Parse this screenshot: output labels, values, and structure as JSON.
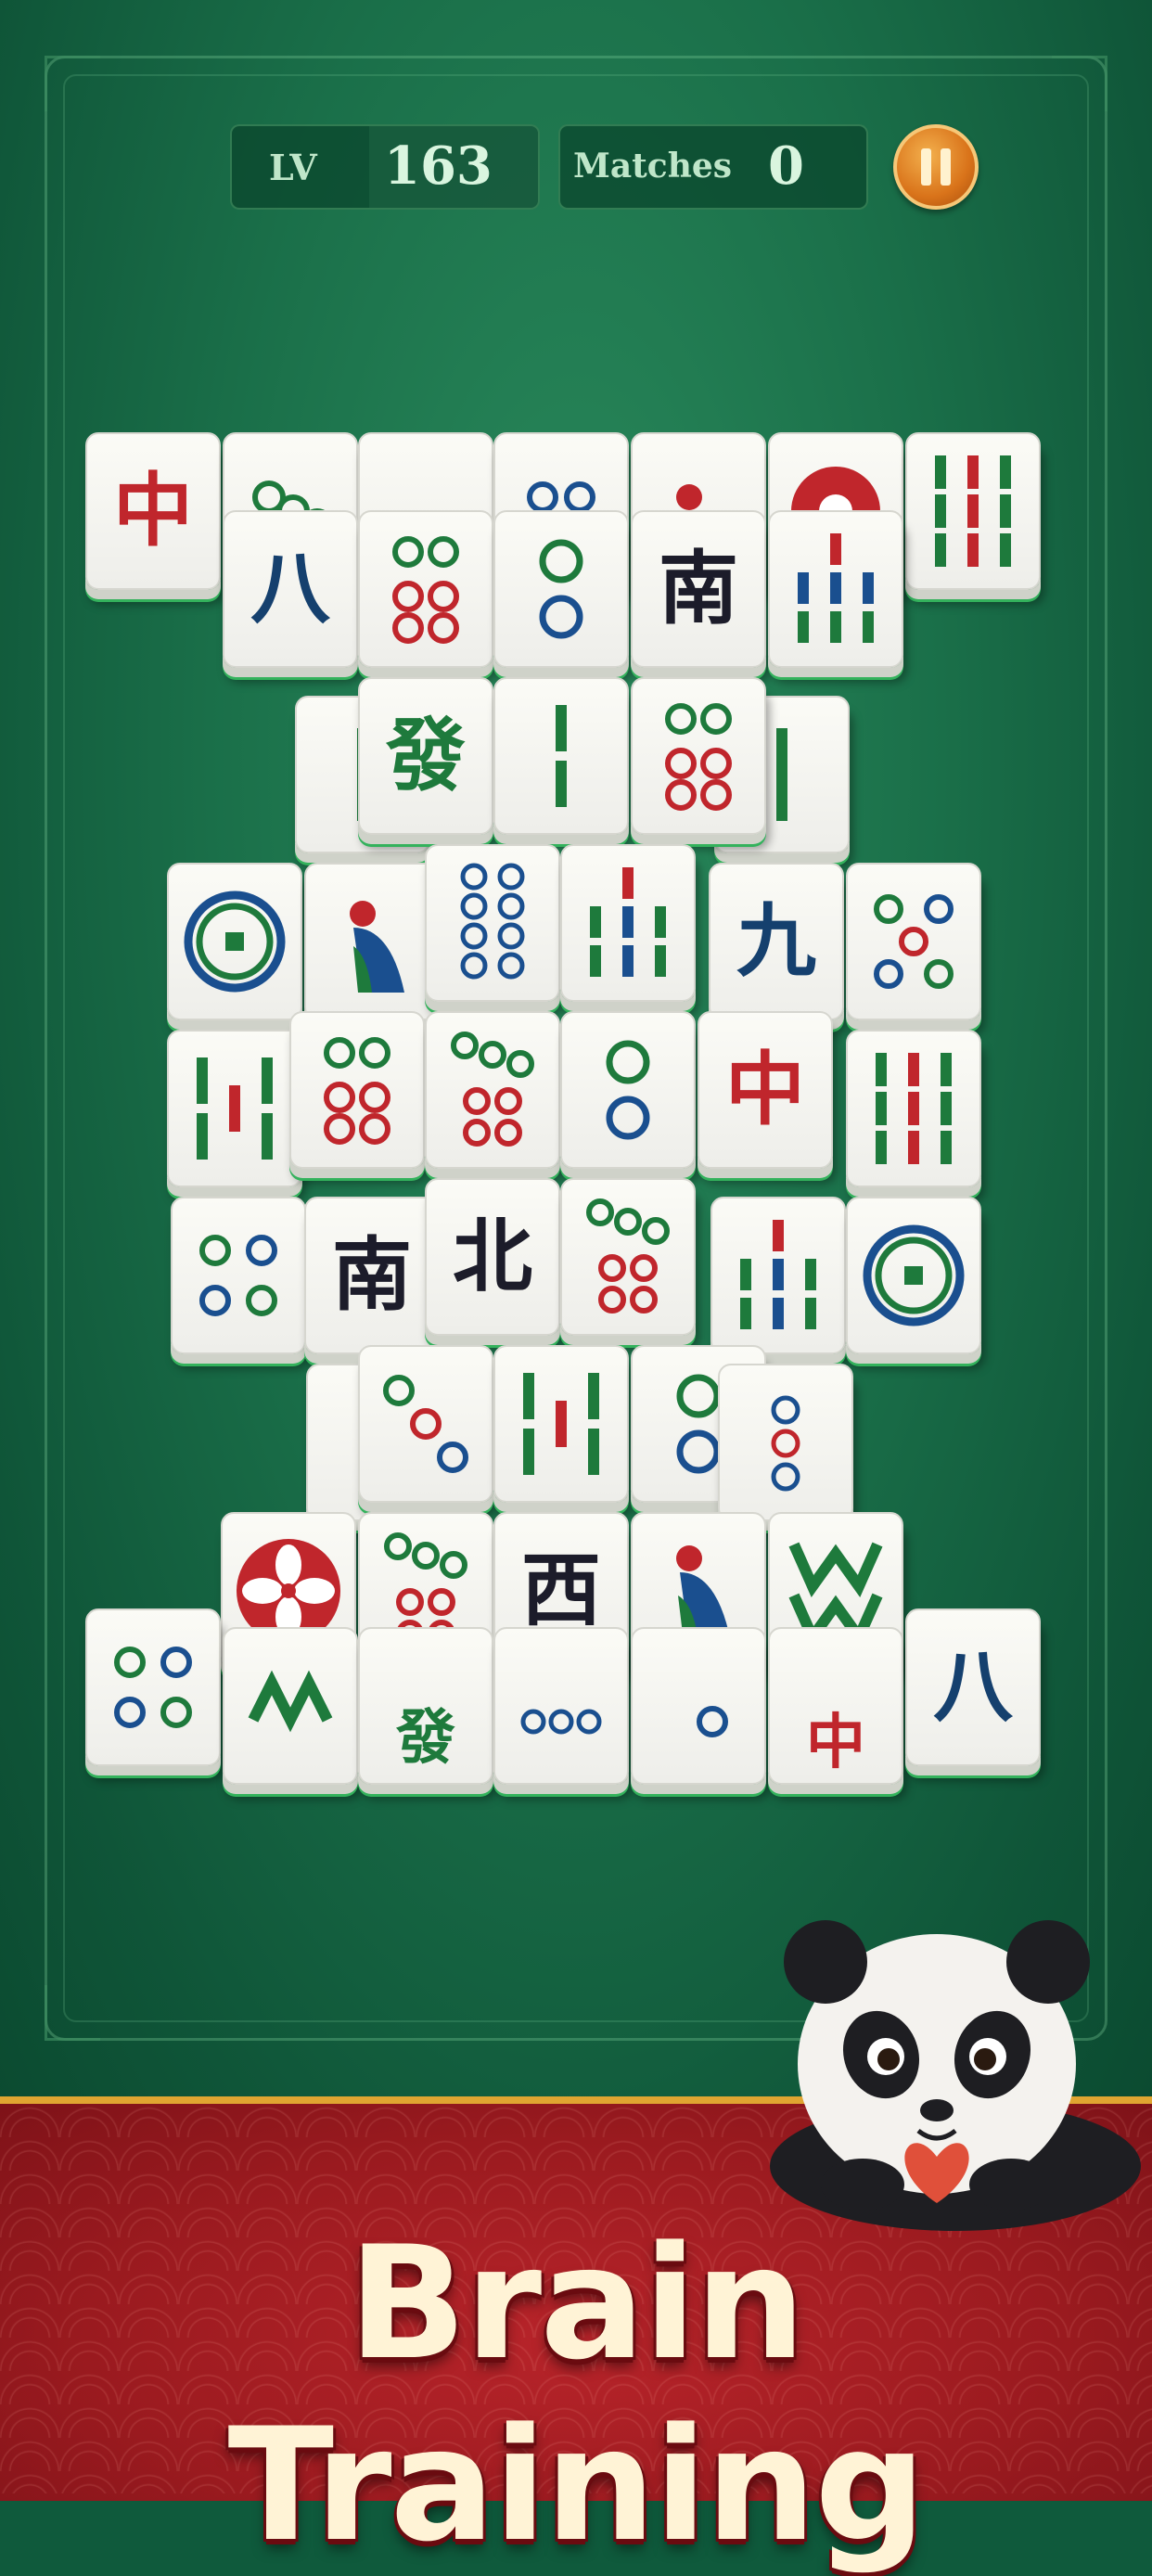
{
  "hud": {
    "level_label": "LV",
    "level_value": "163",
    "matches_label": "Matches",
    "matches_value": "0",
    "pause_icon": "pause-icon"
  },
  "tiles": {
    "t01": "中",
    "t02": "八",
    "t03": "南",
    "t04": "發",
    "t05": "九",
    "t06": "中",
    "t07": "南",
    "t08": "北",
    "t09": "西",
    "t10": "八",
    "t11": "發",
    "t12": "中"
  },
  "banner": {
    "title": "Brain Training"
  },
  "colors": {
    "felt": "#1a6f49",
    "banner_red": "#9a1a1f",
    "pause_orange": "#d9731a",
    "tile_edge": "#33b25c"
  }
}
